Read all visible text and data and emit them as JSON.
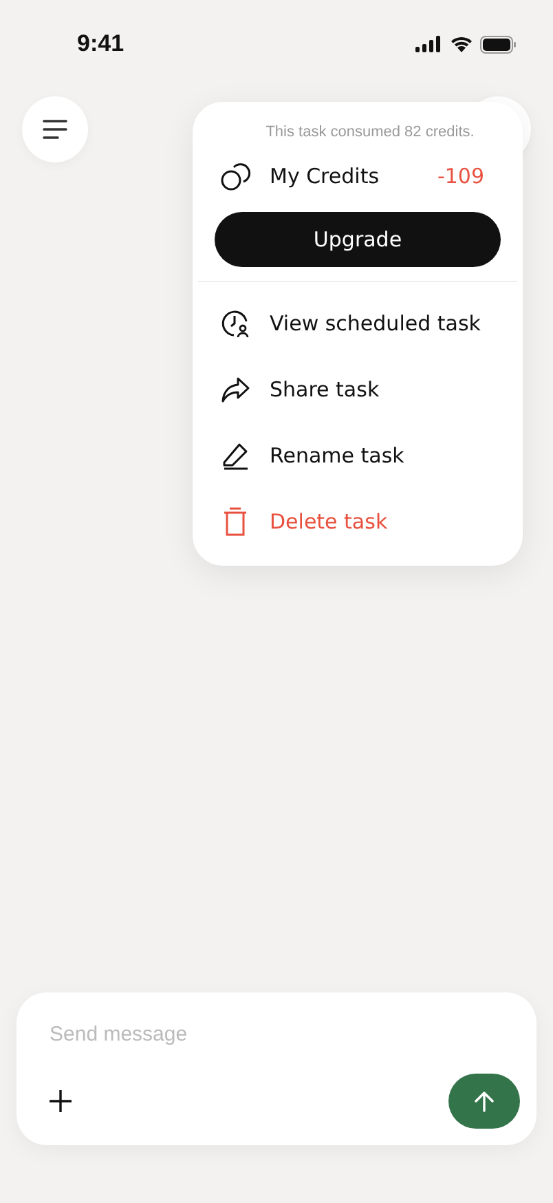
{
  "status_bar": {
    "time": "9:41"
  },
  "menu": {
    "note": "This task consumed 82 credits.",
    "credits_label": "My Credits",
    "credits_value": "-109",
    "upgrade": "Upgrade",
    "items": [
      {
        "kind": "schedule",
        "label": "View scheduled task",
        "destructive": false
      },
      {
        "kind": "share",
        "label": "Share task",
        "destructive": false
      },
      {
        "kind": "rename",
        "label": "Rename task",
        "destructive": false
      },
      {
        "kind": "delete",
        "label": "Delete task",
        "destructive": true
      }
    ]
  },
  "composer": {
    "placeholder": "Send message"
  }
}
